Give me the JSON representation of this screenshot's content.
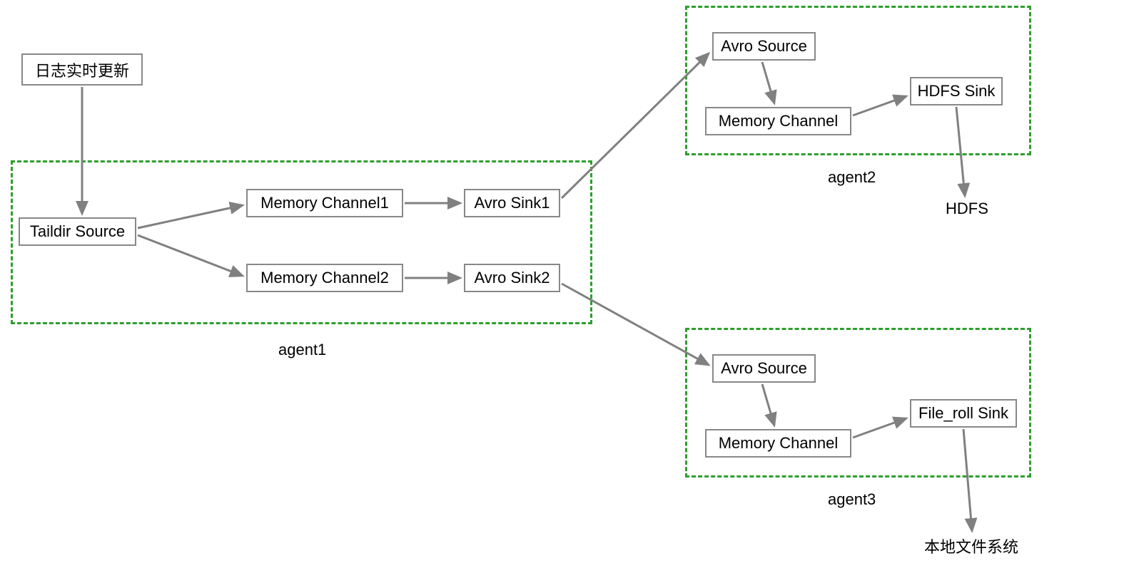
{
  "diagram": {
    "realtime_log": "日志实时更新",
    "agent1": {
      "label": "agent1",
      "taildir_source": "Taildir Source",
      "memory_channel1": "Memory Channel1",
      "memory_channel2": "Memory Channel2",
      "avro_sink1": "Avro Sink1",
      "avro_sink2": "Avro Sink2"
    },
    "agent2": {
      "label": "agent2",
      "avro_source": "Avro Source",
      "memory_channel": "Memory Channel",
      "hdfs_sink": "HDFS Sink",
      "output": "HDFS"
    },
    "agent3": {
      "label": "agent3",
      "avro_source": "Avro Source",
      "memory_channel": "Memory Channel",
      "file_roll_sink": "File_roll Sink",
      "output": "本地文件系统"
    }
  }
}
